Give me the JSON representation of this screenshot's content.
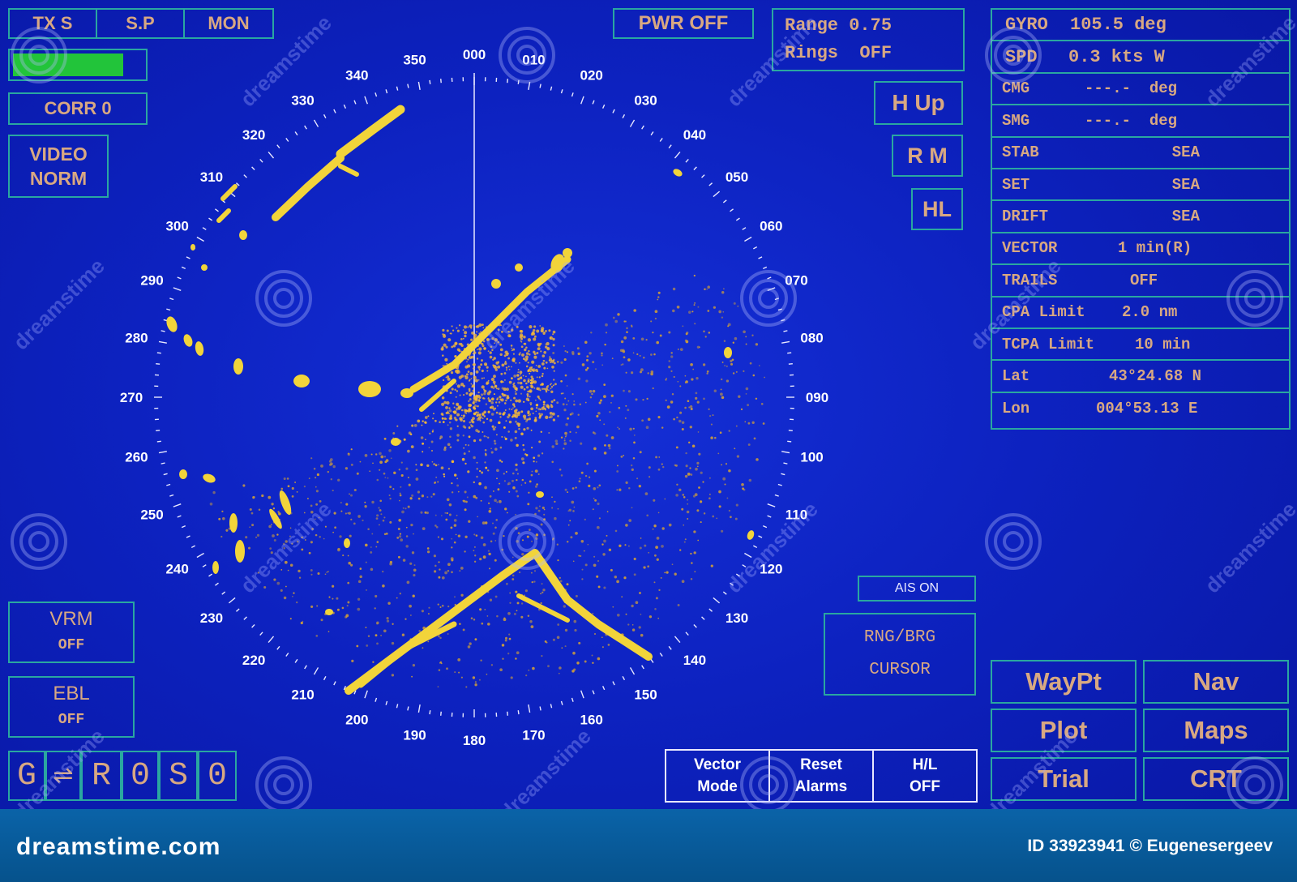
{
  "top_left": {
    "tx_label": "TX S",
    "sp_label": "S.P",
    "mon_label": "MON",
    "signal_level": 0.85,
    "corr_label": "CORR 0",
    "video_line1": "VIDEO",
    "video_line2": "NORM"
  },
  "top_center": {
    "pwr_label": "PWR OFF",
    "range_text": "Range 0.75",
    "rings_text": "Rings  OFF",
    "hup_label": "H Up",
    "rm_label": "R M",
    "hl_label": "HL"
  },
  "info_rows": [
    {
      "name": "gyro",
      "left": "GYRO",
      "right": "105.5 deg"
    },
    {
      "name": "spd",
      "left": "SPD",
      "right": "0.3 kts W"
    },
    {
      "name": "cmg",
      "left": "CMG",
      "right": "---.-  deg"
    },
    {
      "name": "smg",
      "left": "SMG",
      "right": "---.-  deg"
    },
    {
      "name": "stab",
      "left": "STAB",
      "right": "SEA"
    },
    {
      "name": "set",
      "left": "SET",
      "right": "SEA"
    },
    {
      "name": "drift",
      "left": "DRIFT",
      "right": "SEA"
    },
    {
      "name": "vector",
      "left": "VECTOR",
      "right": "1 min(R)"
    },
    {
      "name": "trails",
      "left": "TRAILS",
      "right": "OFF"
    },
    {
      "name": "cpa",
      "left": "CPA Limit",
      "right": "2.0 nm"
    },
    {
      "name": "tcpa",
      "left": "TCPA Limit",
      "right": "10 min"
    },
    {
      "name": "lat",
      "left": "Lat",
      "right": "43°24.68 N"
    },
    {
      "name": "lon",
      "left": "Lon",
      "right": "004°53.13 E"
    }
  ],
  "bearing_labels": [
    "000",
    "010",
    "020",
    "030",
    "040",
    "050",
    "060",
    "070",
    "080",
    "090",
    "100",
    "110",
    "120",
    "130",
    "140",
    "150",
    "160",
    "170",
    "180",
    "190",
    "200",
    "210",
    "220",
    "230",
    "240",
    "250",
    "260",
    "270",
    "280",
    "290",
    "300",
    "310",
    "320",
    "330",
    "340",
    "350"
  ],
  "ais_label": "AIS ON",
  "rng_brg": {
    "line1": "RNG/BRG",
    "line2": "CURSOR"
  },
  "vrm": {
    "title": "VRM",
    "state": "OFF"
  },
  "ebl": {
    "title": "EBL",
    "state": "OFF"
  },
  "bottom_codes": [
    "G",
    "⇌",
    "R",
    "0",
    "S",
    "0"
  ],
  "bottom_buttons": [
    {
      "line1": "Vector",
      "line2": "Mode"
    },
    {
      "line1": "Reset",
      "line2": "Alarms"
    },
    {
      "line1": "H/L",
      "line2": "OFF"
    }
  ],
  "nav_buttons": [
    "WayPt",
    "Nav",
    "Plot",
    "Maps",
    "Trial",
    "CRT"
  ],
  "watermark": {
    "site": "dreamstime.com",
    "credit": "ID 33923941 © Eugenesergeev",
    "overlay_text": "dreamstime"
  },
  "colors": {
    "background": "#0d22c0",
    "accent_border": "#2aa7a0",
    "text": "#d8a882",
    "echo": "#f2d43a",
    "signal_bar": "#22c43a",
    "bottom_bar": "#0a63a8"
  }
}
